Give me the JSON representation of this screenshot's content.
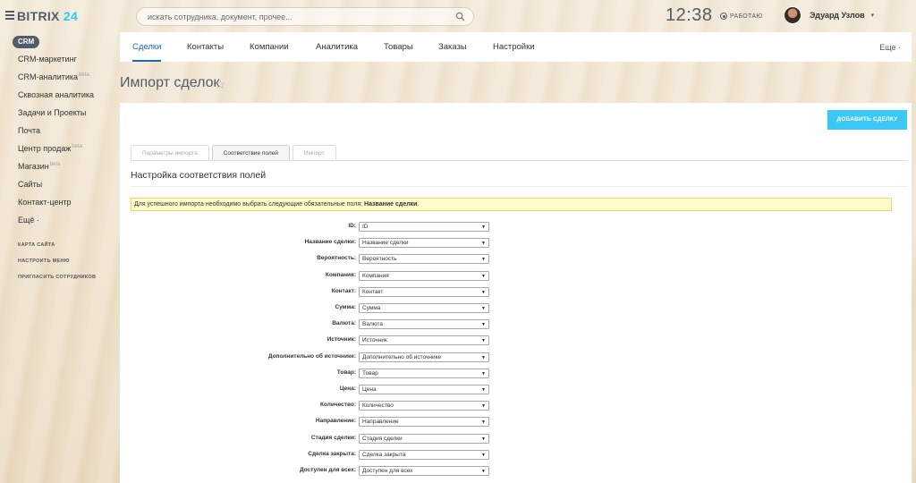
{
  "header": {
    "logo_main": "BITRIX",
    "logo_num": "24",
    "search_placeholder": "искать сотрудника, документ, прочее...",
    "clock": "12:38",
    "work_status": "РАБОТАЮ",
    "user_name": "Эдуард Узлов"
  },
  "sidebar": {
    "badge": "CRM",
    "items": [
      {
        "label": "CRM-маркетинг",
        "beta": ""
      },
      {
        "label": "CRM-аналитика",
        "beta": "beta"
      },
      {
        "label": "Сквозная аналитика",
        "beta": ""
      },
      {
        "label": "Задачи и Проекты",
        "beta": ""
      },
      {
        "label": "Почта",
        "beta": ""
      },
      {
        "label": "Центр продаж",
        "beta": "beta"
      },
      {
        "label": "Магазин",
        "beta": "beta"
      },
      {
        "label": "Сайты",
        "beta": ""
      },
      {
        "label": "Контакт-центр",
        "beta": ""
      },
      {
        "label": "Ещё ·",
        "beta": ""
      }
    ],
    "small_links": [
      "КАРТА САЙТА",
      "НАСТРОИТЬ МЕНЮ",
      "ПРИГЛАСИТЬ СОТРУДНИКОВ"
    ]
  },
  "topnav": {
    "tabs": [
      "Сделки",
      "Контакты",
      "Компании",
      "Аналитика",
      "Товары",
      "Заказы",
      "Настройки"
    ],
    "active_index": 0,
    "more": "Еще ·"
  },
  "page": {
    "title": "Импорт сделок",
    "add_button": "ДОБАВИТЬ СДЕЛКУ",
    "import_tabs": [
      "Параметры импорта",
      "Соответствие полей",
      "Импорт"
    ],
    "active_import_tab": 1,
    "section_title": "Настройка соответствия полей",
    "notice_text": "Для успешного импорта необходимо выбрать следующие обязательные поля: ",
    "notice_bold": "Название сделки",
    "notice_end": "."
  },
  "fields": [
    {
      "label": "ID:",
      "value": "ID"
    },
    {
      "label": "Название сделки:",
      "value": "Название сделки"
    },
    {
      "label": "Вероятность:",
      "value": "Вероятность"
    },
    {
      "label": "Компания:",
      "value": "Компания"
    },
    {
      "label": "Контакт:",
      "value": "Контакт"
    },
    {
      "label": "Сумма:",
      "value": "Сумма"
    },
    {
      "label": "Валюта:",
      "value": "Валюта"
    },
    {
      "label": "Источник:",
      "value": "Источник"
    },
    {
      "label": "Дополнительно об источнике:",
      "value": "Дополнительно об источнике"
    },
    {
      "label": "Товар:",
      "value": "Товар"
    },
    {
      "label": "Цена:",
      "value": "Цена"
    },
    {
      "label": "Количество:",
      "value": "Количество"
    },
    {
      "label": "Направление:",
      "value": "Направление"
    },
    {
      "label": "Стадия сделки:",
      "value": "Стадия сделки"
    },
    {
      "label": "Сделка закрыта:",
      "value": "Сделка закрыта"
    },
    {
      "label": "Доступен для всех:",
      "value": "Доступен для всех"
    }
  ],
  "colors": {
    "accent": "#2067b0",
    "button": "#3bc8f5",
    "notice_bg": "#fffac9"
  }
}
